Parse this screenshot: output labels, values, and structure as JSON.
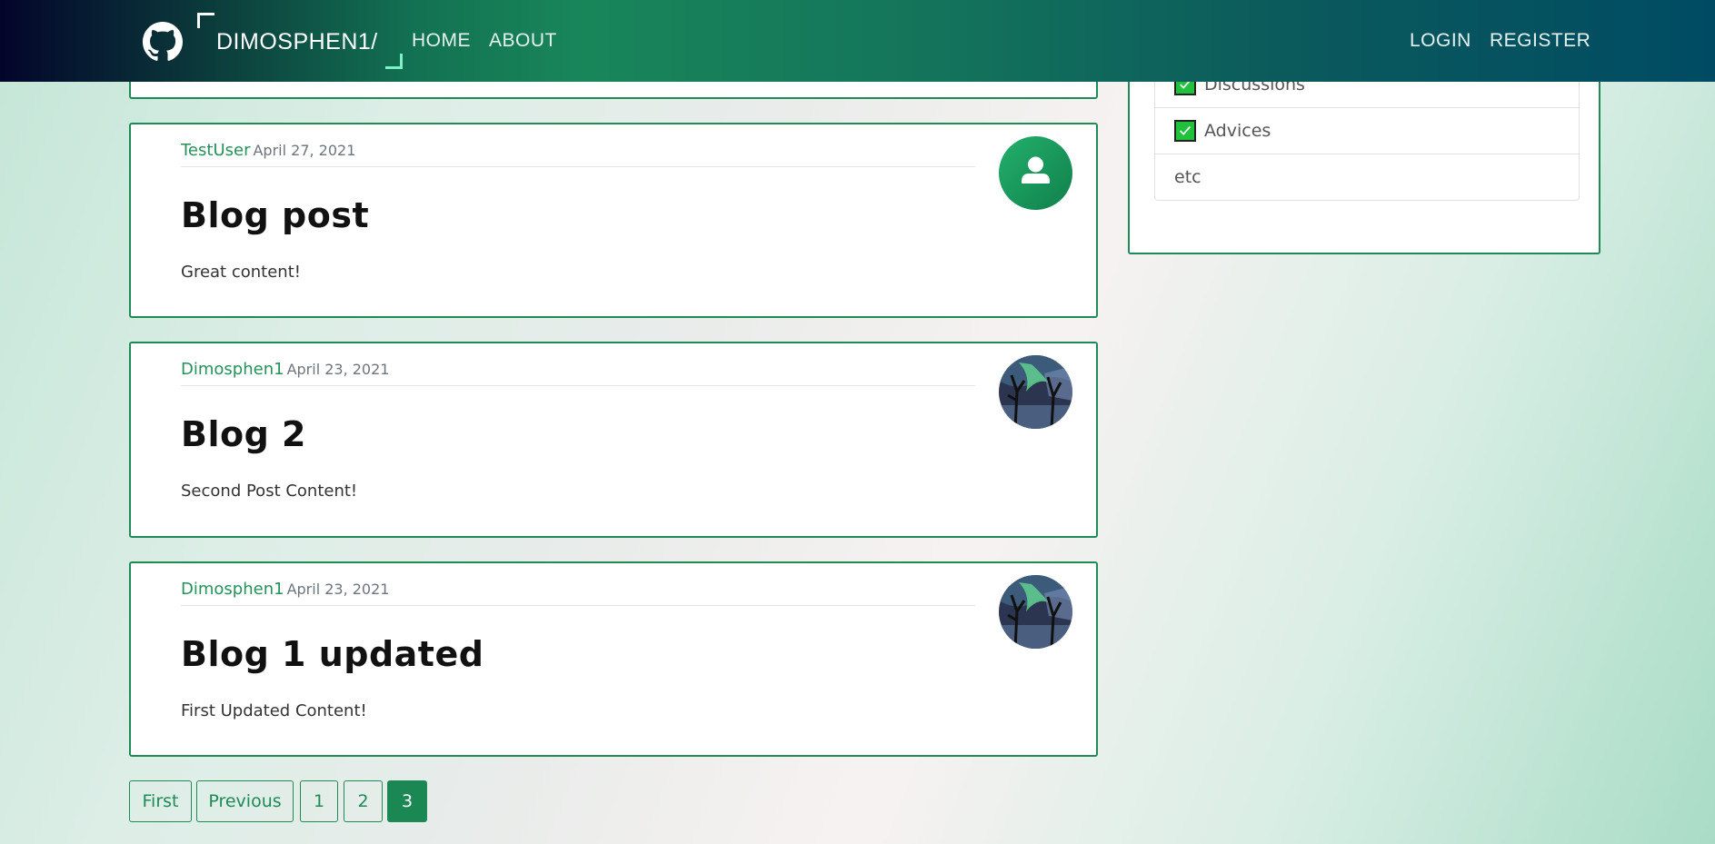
{
  "navbar": {
    "brand": "DIMOSPHEN1/",
    "links": [
      "HOME",
      "ABOUT"
    ],
    "auth": [
      "LOGIN",
      "REGISTER"
    ]
  },
  "posts": [
    {
      "author": "TestUser",
      "date": "April 27, 2021",
      "title": "Blog post",
      "content": "Great content!",
      "avatar": "default-user-icon"
    },
    {
      "author": "Dimosphen1",
      "date": "April 23, 2021",
      "title": "Blog 2",
      "content": "Second Post Content!",
      "avatar": "aurora-tree-photo"
    },
    {
      "author": "Dimosphen1",
      "date": "April 23, 2021",
      "title": "Blog 1 updated",
      "content": "First Updated Content!",
      "avatar": "aurora-tree-photo"
    }
  ],
  "sidebar": {
    "items": [
      {
        "label": "Discussions",
        "checked": true
      },
      {
        "label": "Advices",
        "checked": true
      },
      {
        "label": "etc",
        "checked": false
      }
    ]
  },
  "pagination": {
    "first": "First",
    "previous": "Previous",
    "pages": [
      "1",
      "2",
      "3"
    ],
    "current": "3"
  },
  "colors": {
    "accent": "#1f8a55",
    "checkbox": "#1fc23a"
  }
}
